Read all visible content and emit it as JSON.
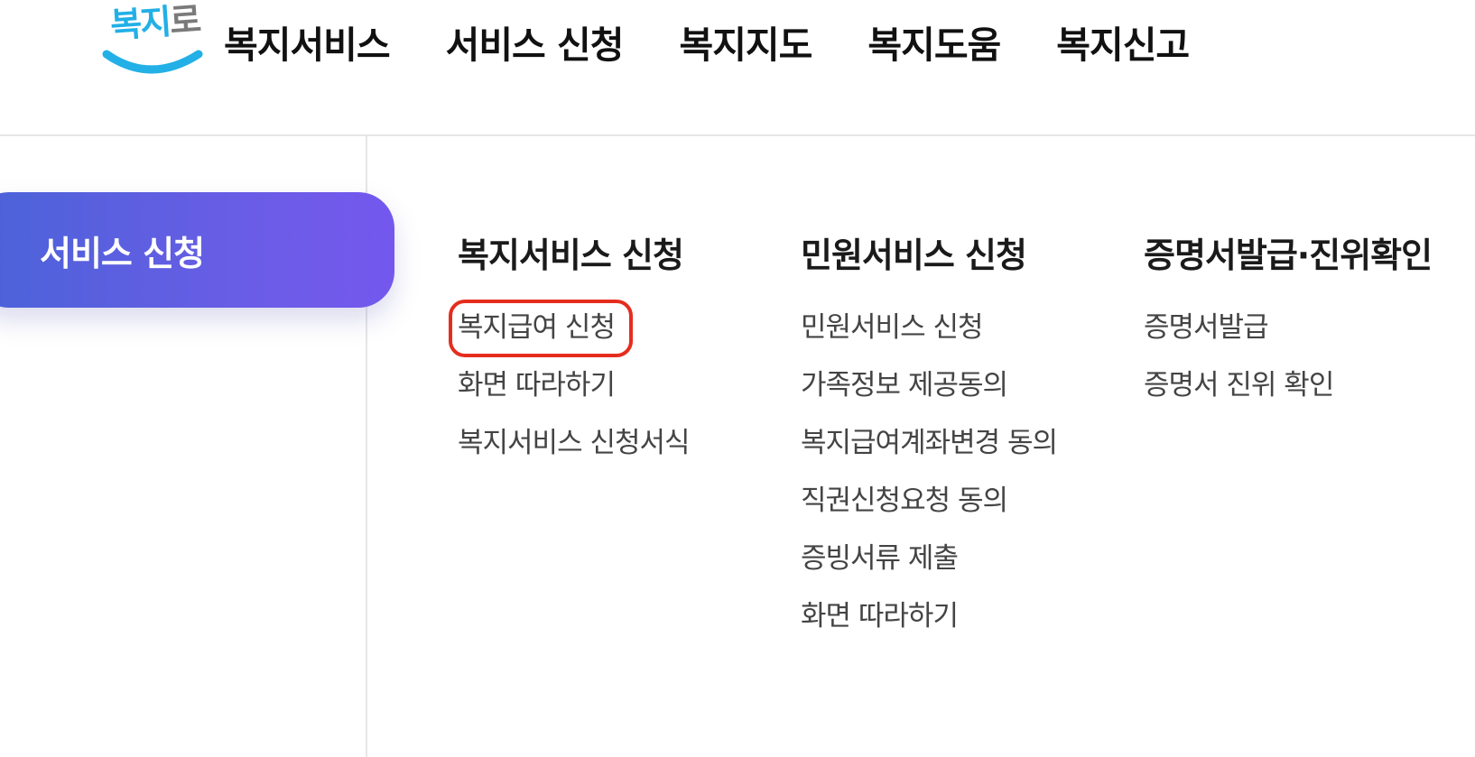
{
  "logo": {
    "text_main": "복지",
    "text_accent": "로",
    "colors": {
      "blue": "#22b0e6",
      "gray": "#7a7a7a"
    }
  },
  "gnb": {
    "items": [
      {
        "label": "복지서비스"
      },
      {
        "label": "서비스 신청"
      },
      {
        "label": "복지지도"
      },
      {
        "label": "복지도움"
      },
      {
        "label": "복지신고"
      }
    ]
  },
  "sidebar": {
    "active_label": "서비스 신청",
    "active_gradient": [
      "#4a63d8",
      "#7458ee"
    ]
  },
  "submenu": {
    "columns": [
      {
        "title": "복지서비스 신청",
        "items": [
          "복지급여 신청",
          "화면 따라하기",
          "복지서비스 신청서식"
        ]
      },
      {
        "title": "민원서비스 신청",
        "items": [
          "민원서비스 신청",
          "가족정보 제공동의",
          "복지급여계좌변경 동의",
          "직권신청요청 동의",
          "증빙서류 제출",
          "화면 따라하기"
        ]
      },
      {
        "title": "증명서발급·진위확인",
        "items": [
          "증명서발급",
          "증명서 진위 확인"
        ]
      }
    ],
    "highlighted_item": "복지급여 신청",
    "highlight_color": "#e52d1e"
  }
}
